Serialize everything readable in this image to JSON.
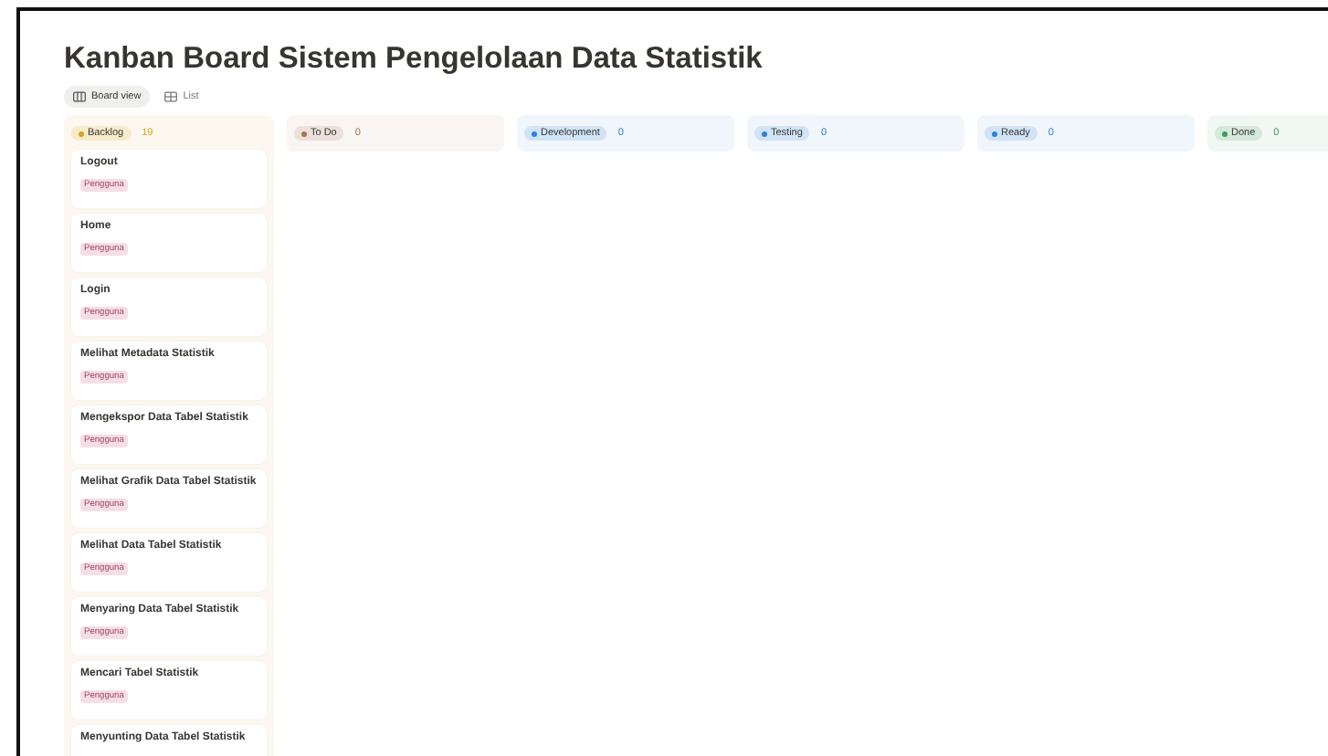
{
  "title": "Kanban Board Sistem Pengelolaan Data Statistik",
  "views": [
    {
      "label": "Board view",
      "kind": "board",
      "selected": true
    },
    {
      "label": "List",
      "kind": "list",
      "selected": false
    }
  ],
  "columns": [
    {
      "name": "Backlog",
      "count": "19",
      "color": "#d9a21b",
      "cards": [
        {
          "title": "Logout",
          "tag": "Pengguna"
        },
        {
          "title": "Home",
          "tag": "Pengguna"
        },
        {
          "title": "Login",
          "tag": "Pengguna"
        },
        {
          "title": "Melihat Metadata Statistik",
          "tag": "Pengguna"
        },
        {
          "title": "Mengekspor Data Tabel Statistik",
          "tag": "Pengguna"
        },
        {
          "title": "Melihat Grafik Data Tabel Statistik",
          "tag": "Pengguna"
        },
        {
          "title": "Melihat Data Tabel Statistik",
          "tag": "Pengguna"
        },
        {
          "title": "Menyaring Data Tabel Statistik",
          "tag": "Pengguna"
        },
        {
          "title": "Mencari Tabel Statistik",
          "tag": "Pengguna"
        },
        {
          "title": "Menyunting Data Tabel Statistik"
        }
      ]
    },
    {
      "name": "To Do",
      "count": "0",
      "color": "#a8735a"
    },
    {
      "name": "Development",
      "count": "0",
      "color": "#2f80d8"
    },
    {
      "name": "Testing",
      "count": "0",
      "color": "#2f80d8"
    },
    {
      "name": "Ready",
      "count": "0",
      "color": "#2f80d8"
    },
    {
      "name": "Done",
      "count": "0",
      "color": "#3d9a5e"
    }
  ]
}
